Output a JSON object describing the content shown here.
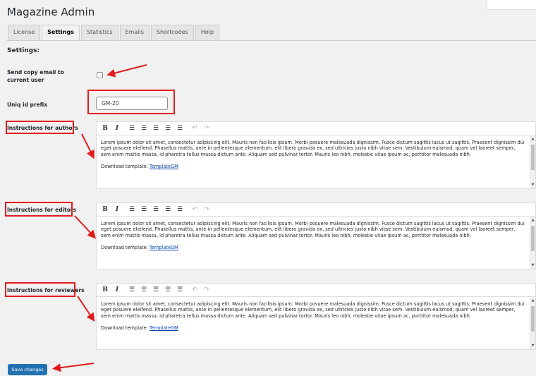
{
  "page": {
    "title": "Magazine Admin"
  },
  "tabs": [
    {
      "label": "License"
    },
    {
      "label": "Settings"
    },
    {
      "label": "Statistics"
    },
    {
      "label": "Emails"
    },
    {
      "label": "Shortcodes"
    },
    {
      "label": "Help"
    }
  ],
  "active_tab": "Settings",
  "section": {
    "title": "Settings:"
  },
  "copy_email": {
    "label": "Send copy email to current user",
    "checked": false
  },
  "uniq_prefix": {
    "label": "Uniq id prefix",
    "value": "GM-20"
  },
  "editors": [
    {
      "label": "Instructions for authors",
      "body": "Lorem ipsum dolor sit amet, consectetur adipiscing elit. Mauris non facilisis ipsum. Morbi posuere malesuada dignissim. Fusce dictum sagittis lacus ut sagittis. Praesent dignissim dui eget posuere eleifend. Phasellus mattis, ante in pellentesque elementum, elit libero gravida ex, sed ultricies justo nibh vitae sem. Vestibulum euismod, quam vel laoreet semper, sem enim mattis massa, id pharetra tellus massa dictum ante. Aliquam sed pulvinar tortor. Mauris leo nibh, molestie vitae ipsum ac, porttitor malesuada nibh.",
      "download_label": "Download template:",
      "download_link": "TemplateGM"
    },
    {
      "label": "Instructions for editors",
      "body": "Lorem ipsum dolor sit amet, consectetur adipiscing elit. Mauris non facilisis ipsum. Morbi posuere malesuada dignissim. Fusce dictum sagittis lacus ut sagittis. Praesent dignissim dui eget posuere eleifend. Phasellus mattis, ante in pellentesque elementum, elit libero gravida ex, sed ultricies justo nibh vitae sem. Vestibulum euismod, quam vel laoreet semper, sem enim mattis massa, id pharetra tellus massa dictum ante. Aliquam sed pulvinar tortor. Mauris leo nibh, molestie vitae ipsum ac, porttitor malesuada nibh.",
      "download_label": "Download template:",
      "download_link": "TemplateGM"
    },
    {
      "label": "Instructions for reviewers",
      "body": "Lorem ipsum dolor sit amet, consectetur adipiscing elit. Mauris non facilisis ipsum. Morbi posuere malesuada dignissim. Fusce dictum sagittis lacus ut sagittis. Praesent dignissim dui eget posuere eleifend. Phasellus mattis, ante in pellentesque elementum, elit libero gravida ex, sed ultricies justo nibh vitae sem. Vestibulum euismod, quam vel laoreet semper, sem enim mattis massa, id pharetra tellus massa dictum ante. Aliquam sed pulvinar tortor. Mauris leo nibh, molestie vitae ipsum ac, porttitor malesuada nibh.",
      "download_label": "Download template:",
      "download_link": "TemplateGM"
    }
  ],
  "toolbar": {
    "bold": "B",
    "italic": "I",
    "icons": [
      "bold-icon",
      "italic-icon",
      "unordered-list-icon",
      "align-center-icon",
      "align-left-icon",
      "align-right-icon",
      "indent-icon",
      "undo-icon",
      "redo-icon"
    ]
  },
  "save_button": {
    "label": "Save changes"
  },
  "colors": {
    "annotation": "#e21c1c",
    "primary": "#2271b1",
    "background": "#f1f1f1"
  }
}
